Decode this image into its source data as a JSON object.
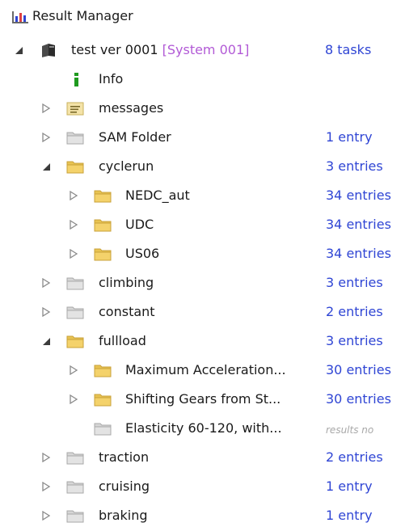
{
  "root": {
    "title": "Result Manager"
  },
  "project": {
    "name": "test ver 0001",
    "system": "[System 001]",
    "count": "8 tasks"
  },
  "rows": [
    {
      "label": "Info",
      "count": ""
    },
    {
      "label": "messages",
      "count": ""
    },
    {
      "label": "SAM Folder",
      "count": "1 entry"
    },
    {
      "label": "cyclerun",
      "count": "3 entries"
    },
    {
      "label": "NEDC_aut",
      "count": "34 entries"
    },
    {
      "label": "UDC",
      "count": "34 entries"
    },
    {
      "label": "US06",
      "count": "34 entries"
    },
    {
      "label": "climbing",
      "count": "3 entries"
    },
    {
      "label": "constant",
      "count": "2 entries"
    },
    {
      "label": "fullload",
      "count": "3 entries"
    },
    {
      "label": "Maximum Acceleration...",
      "count": "30 entries"
    },
    {
      "label": "Shifting Gears from St...",
      "count": "30 entries"
    },
    {
      "label": "Elasticity 60-120, with...",
      "count": "results no"
    },
    {
      "label": "traction",
      "count": "2 entries"
    },
    {
      "label": "cruising",
      "count": "1 entry"
    },
    {
      "label": "braking",
      "count": "1 entry"
    }
  ],
  "colors": {
    "count_text": "#2f45d4",
    "system_text": "#b25ad6",
    "folder_yellow": "#f4d26b",
    "folder_gray": "#cfcfcf",
    "info_green": "#1f9a1f"
  }
}
